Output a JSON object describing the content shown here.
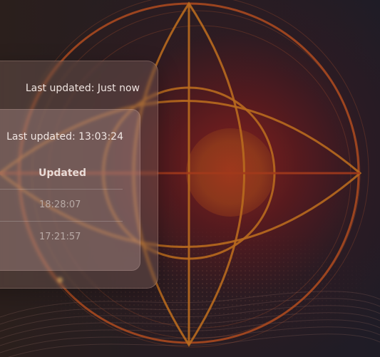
{
  "outer_panel": {
    "last_updated": "Last updated: Just now"
  },
  "inner_panel": {
    "last_updated": "Last updated: 13:03:24",
    "table": {
      "header": "Updated",
      "rows": [
        {
          "updated": "18:28:07"
        },
        {
          "updated": "17:21:57"
        }
      ]
    }
  }
}
